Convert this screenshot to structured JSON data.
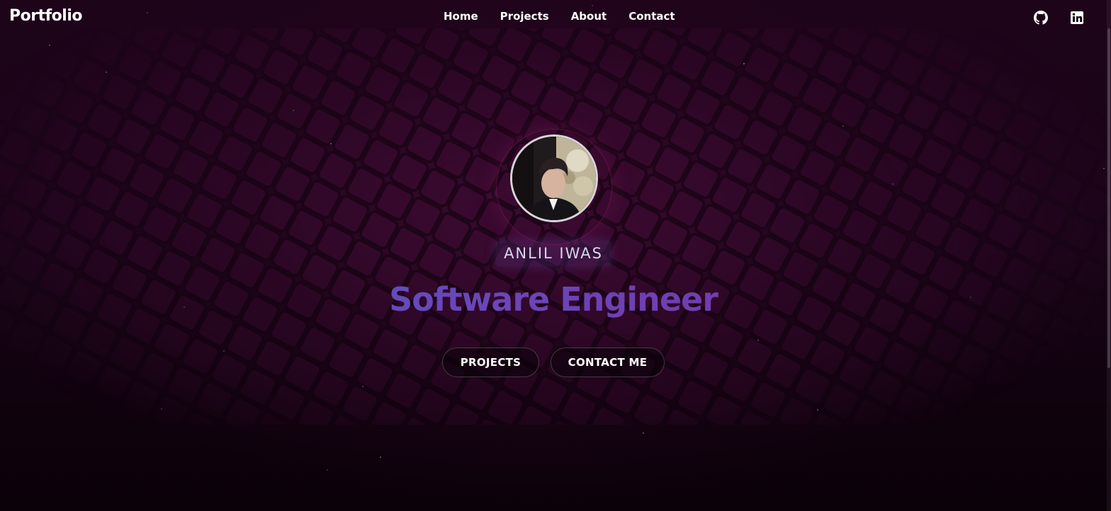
{
  "header": {
    "logo": "Portfolio",
    "nav": [
      {
        "label": "Home"
      },
      {
        "label": "Projects"
      },
      {
        "label": "About"
      },
      {
        "label": "Contact"
      }
    ],
    "social": [
      {
        "icon": "github-icon"
      },
      {
        "icon": "linkedin-icon"
      }
    ]
  },
  "hero": {
    "name": "ANLIL IWAS",
    "role": "Software Engineer",
    "buttons": {
      "projects": "PROJECTS",
      "contact": "CONTACT ME"
    }
  },
  "colors": {
    "background": "#1a0418",
    "accent_start": "#4e59c4",
    "accent_end": "#7a2f9e",
    "text": "#ffffff"
  }
}
